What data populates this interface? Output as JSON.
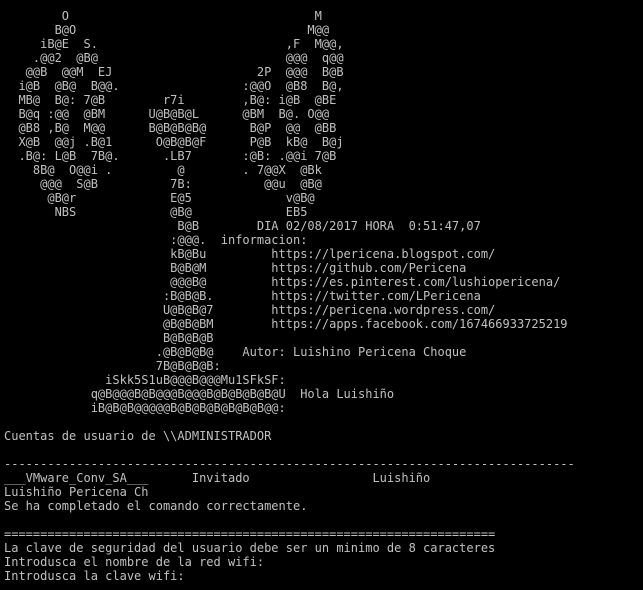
{
  "console": {
    "lines": [
      "        O                                  M",
      "       B@O                                M@@",
      "     iB@E  S.                          ,F  M@@,",
      "    .@@2  @B@                          @@@  q@@",
      "   @@B  @@M  EJ                    2P  @@@  B@B",
      "  i@B  @B@  B@@.                 :@@O  @B8  B@,",
      "  MB@  B@: 7@B        r7i        ,B@: i@B  @BE",
      "  B@q :@@  @BM      U@B@B@L      @BM  B@. O@@",
      "  @B8 ,B@  M@@      B@B@B@B@      B@P  @@  @BB",
      "  X@B  @@j .B@1      O@B@B@F      P@B  kB@  B@j",
      "  .B@: L@B  7B@.      .LB7       :@B: .@@i 7@B",
      "    8B@  O@@i .         @        . 7@@X  @Bk",
      "     @@@  S@B          7B:          @@u  @B@",
      "      @B@r             E@5             v@B@",
      "       NBS             @B@             EB5",
      "                        B@B        DIA 02/08/2017 HORA  0:51:47,07",
      "                       :@@@.  informacion:",
      "                       kB@Bu         https://lpericena.blogspot.com/",
      "                       B@B@M         https://github.com/Pericena",
      "                       @@@B@         https://es.pinterest.com/lushiopericena/",
      "                      :B@B@B.        https://twitter.com/LPericena",
      "                      U@B@B@7        https://pericena.wordpress.com/",
      "                      @B@B@BM        https://apps.facebook.com/167466933725219",
      "                      B@B@B@B",
      "                     .@B@B@B@    Autor: Luishino Pericena Choque",
      "                     7B@B@B@B:",
      "              iSkk5S1uB@@@B@@@Mu1SFkSF:",
      "            q@B@@@B@B@@@B@@@B@B@B@B@B@U  Hola Luishiño",
      "            iB@B@B@@@@@B@B@B@B@B@B@B@@:",
      "",
      "Cuentas de usuario de \\\\ADMINISTRADOR",
      "",
      "-------------------------------------------------------------------------------",
      "___VMware_Conv_SA___      Invitado                 Luishiño",
      "Luishiño Pericena Ch",
      "Se ha completado el comando correctamente.",
      "",
      "====================================================================",
      "La clave de seguridad del usuario debe ser un minimo de 8 caracteres",
      "Introdusca el nombre de la red wifi:",
      "Introdusca la clave wifi:"
    ]
  }
}
